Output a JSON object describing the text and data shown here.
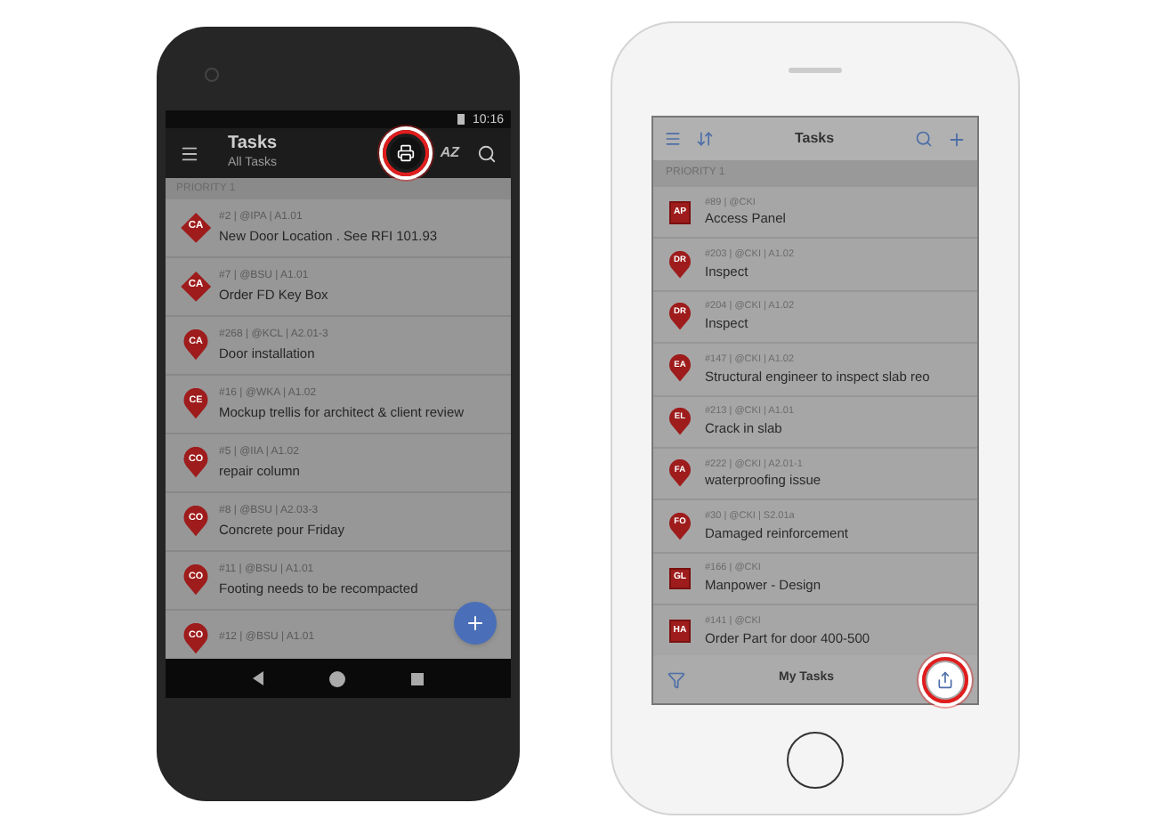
{
  "android": {
    "status_bar": {
      "time": "10:16"
    },
    "toolbar": {
      "title": "Tasks",
      "subtitle": "All Tasks",
      "actions": [
        {
          "kind": "print",
          "highlighted": true
        },
        {
          "kind": "sort",
          "label": "AZ",
          "highlighted": false
        },
        {
          "kind": "search",
          "highlighted": false
        }
      ]
    },
    "section": "PRIORITY 1",
    "tasks": [
      {
        "kind": "diamond",
        "badge": "CA",
        "meta": "#2 | @IPA | A1.01",
        "title": "New Door Location . See RFI 101.93"
      },
      {
        "kind": "diamond",
        "badge": "CA",
        "meta": "#7 | @BSU | A1.01",
        "title": "Order FD Key Box"
      },
      {
        "kind": "pin",
        "badge": "CA",
        "meta": "#268 | @KCL | A2.01-3",
        "title": "Door installation"
      },
      {
        "kind": "pin",
        "badge": "CE",
        "meta": "#16 | @WKA | A1.02",
        "title": "Mockup trellis for architect & client review"
      },
      {
        "kind": "pin",
        "badge": "CO",
        "meta": "#5 | @IIA | A1.02",
        "title": "repair column"
      },
      {
        "kind": "pin",
        "badge": "CO",
        "meta": "#8 | @BSU | A2.03-3",
        "title": "Concrete pour Friday"
      },
      {
        "kind": "pin",
        "badge": "CO",
        "meta": "#11 | @BSU | A1.01",
        "title": "Footing needs to be recompacted"
      },
      {
        "kind": "pin",
        "badge": "CO",
        "meta": "#12 | @BSU | A1.01"
      }
    ]
  },
  "iphone": {
    "header": {
      "title": "Tasks"
    },
    "section": "PRIORITY 1",
    "tasks": [
      {
        "kind": "square",
        "badge": "AP",
        "meta": "#89 | @CKI",
        "title": "Access Panel"
      },
      {
        "kind": "pin",
        "badge": "DR",
        "meta": "#203 | @CKI | A1.02",
        "title": "Inspect"
      },
      {
        "kind": "pin",
        "badge": "DR",
        "meta": "#204 | @CKI | A1.02",
        "title": "Inspect"
      },
      {
        "kind": "pin",
        "badge": "EA",
        "meta": "#147 | @CKI | A1.02",
        "title": "Structural engineer to inspect slab reo"
      },
      {
        "kind": "pin",
        "badge": "EL",
        "meta": "#213 | @CKI | A1.01",
        "title": "Crack in slab"
      },
      {
        "kind": "pin",
        "badge": "FA",
        "meta": "#222 | @CKI | A2.01-1",
        "title": "waterproofing issue"
      },
      {
        "kind": "pin",
        "badge": "FO",
        "meta": "#30 | @CKI | S2.01a",
        "title": "Damaged reinforcement"
      },
      {
        "kind": "square",
        "badge": "GL",
        "meta": "#166 | @CKI",
        "title": "Manpower - Design"
      },
      {
        "kind": "square",
        "badge": "HA",
        "meta": "#141 | @CKI",
        "title": "Order Part for door 400-500"
      }
    ],
    "bottom_bar": {
      "title": "My Tasks",
      "share_highlighted": true
    }
  }
}
